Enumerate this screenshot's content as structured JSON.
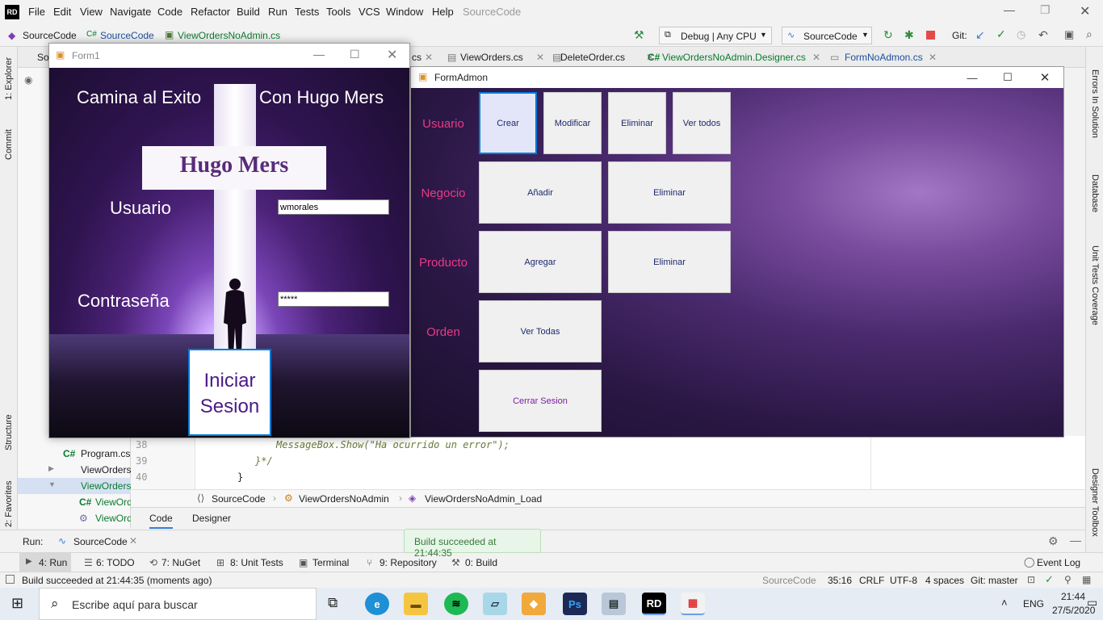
{
  "ide": {
    "menu": [
      "File",
      "Edit",
      "View",
      "Navigate",
      "Code",
      "Refactor",
      "Build",
      "Run",
      "Tests",
      "Tools",
      "VCS",
      "Window",
      "Help"
    ],
    "menu_title": "SourceCode",
    "logo": "RD",
    "toolbar": {
      "crumb1": "SourceCode",
      "crumb2": "SourceCode",
      "crumb3": "ViewOrdersNoAdmin.cs",
      "config": "Debug | Any CPU",
      "project": "SourceCode",
      "git": "Git:"
    },
    "tabs": [
      "cs",
      "ViewOrders.cs",
      "DeleteOrder.cs",
      "ViewOrdersNoAdmin.Designer.cs",
      "FormNoAdmon.cs"
    ],
    "tab_partial_left": "So",
    "tab_prefix_cs": "C#",
    "left_tools": [
      "1: Explorer",
      "Commit",
      "Structure",
      "2: Favorites"
    ],
    "right_tools": [
      "Errors In Solution",
      "Database",
      "Unit Tests Coverage",
      "Designer Toolbox"
    ],
    "explorer": [
      {
        "icon": "C#",
        "label": "Program.cs"
      },
      {
        "icon": "▶",
        "label": "ViewOrders"
      },
      {
        "icon": "▼",
        "label": "ViewOrders"
      },
      {
        "icon": "C#",
        "label": "ViewOrd"
      },
      {
        "icon": "⚙",
        "label": "ViewOrd"
      }
    ],
    "code_lines": [
      {
        "num": "38",
        "text": "MessageBox.Show(\"Ha ocurrido un error\");"
      },
      {
        "num": "39",
        "text": "}*/"
      },
      {
        "num": "40",
        "text": "}"
      }
    ],
    "breadcrumb": [
      "SourceCode",
      "ViewOrdersNoAdmin",
      "ViewOrdersNoAdmin_Load"
    ],
    "editor_tabs": [
      "Code",
      "Designer"
    ],
    "run": {
      "label": "Run:",
      "config": "SourceCode"
    },
    "toast": "Build succeeded at 21:44:35",
    "tool_windows": [
      "4: Run",
      "6: TODO",
      "7: NuGet",
      "8: Unit Tests",
      "Terminal",
      "9: Repository",
      "0: Build"
    ],
    "event_log": "Event Log",
    "status": {
      "message": "Build succeeded at 21:44:35 (moments ago)",
      "project": "SourceCode",
      "position": "35:16",
      "line_ending": "CRLF",
      "encoding": "UTF-8",
      "indent": "4 spaces",
      "git": "Git: master"
    }
  },
  "form1": {
    "title": "Form1",
    "heading_left": "Camina al Exito",
    "heading_right": "Con Hugo Mers",
    "banner": "Hugo Mers",
    "user_label": "Usuario",
    "user_value": "wmorales",
    "pass_label": "Contraseña",
    "pass_value": "*****",
    "login_line1": "Iniciar",
    "login_line2": "Sesion"
  },
  "formadmon": {
    "title": "FormAdmon",
    "rows": [
      "Usuario",
      "Negocio",
      "Producto",
      "Orden"
    ],
    "usuario_buttons": [
      "Crear",
      "Modificar",
      "Eliminar",
      "Ver todos"
    ],
    "negocio_buttons": [
      "Añadir",
      "Eliminar"
    ],
    "producto_buttons": [
      "Agregar",
      "Eliminar"
    ],
    "orden_buttons": [
      "Ver Todas"
    ],
    "logout": "Cerrar Sesion",
    "accent": "#e83b86"
  },
  "taskbar": {
    "search_placeholder": "Escribe aquí para buscar",
    "lang": "ENG",
    "time": "21:44",
    "date": "27/5/2020"
  }
}
